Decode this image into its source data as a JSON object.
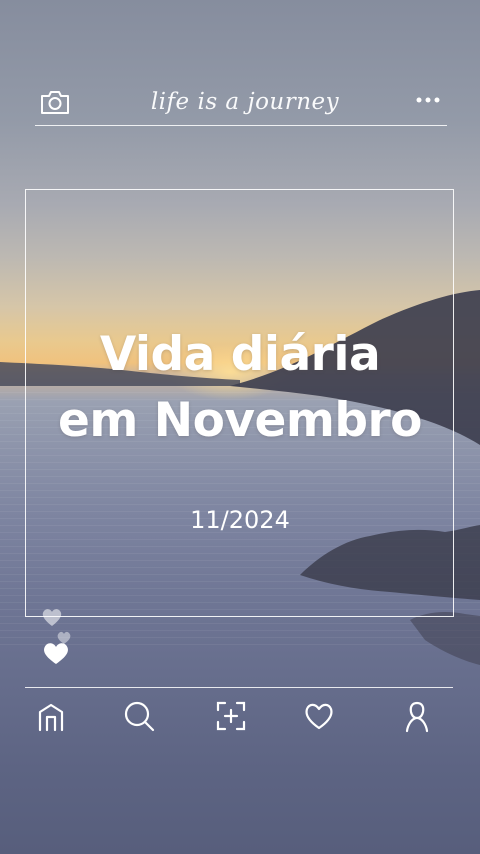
{
  "header": {
    "tagline": "life is a journey",
    "left_icon": "camera-icon",
    "right_icon": "more-dots-icon"
  },
  "card": {
    "title_line1": "Vida diária",
    "title_line2": "em Novembro",
    "date": "11/2024"
  },
  "decor": {
    "hearts_icon": "hearts-icon"
  },
  "nav": {
    "items": [
      {
        "name": "home",
        "icon": "home-icon"
      },
      {
        "name": "search",
        "icon": "search-icon"
      },
      {
        "name": "add",
        "icon": "add-square-icon"
      },
      {
        "name": "favorites",
        "icon": "heart-icon"
      },
      {
        "name": "profile",
        "icon": "user-icon"
      }
    ]
  },
  "colors": {
    "sky_top": "#868d9e",
    "sun_glow": "#f0c27e",
    "water": "#6f7695",
    "line": "#ffffff"
  }
}
